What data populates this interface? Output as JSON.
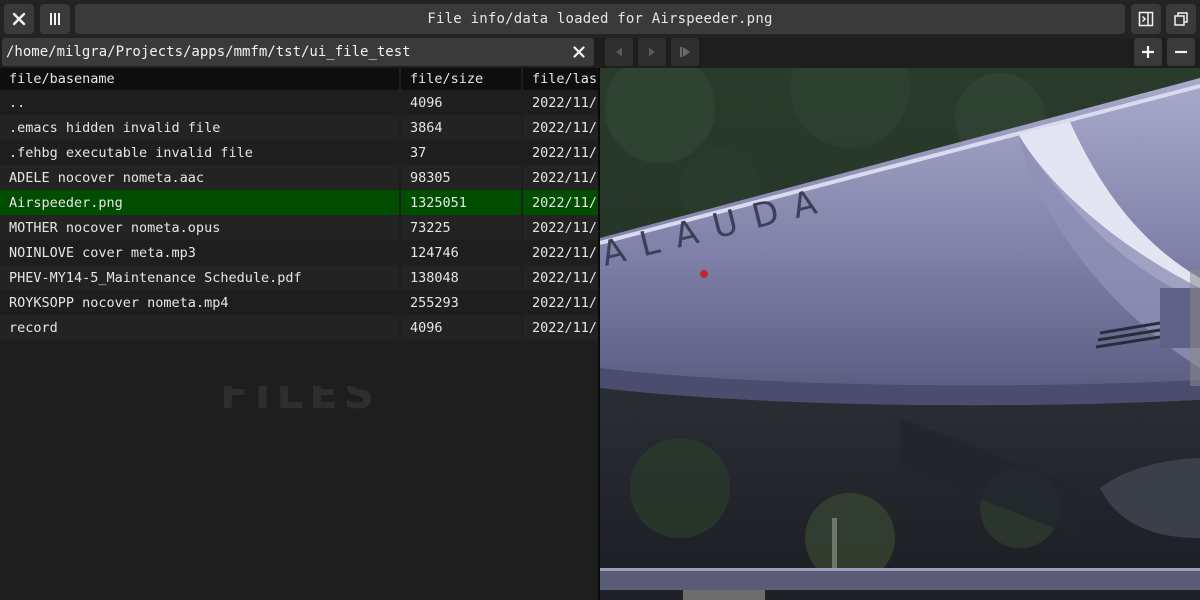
{
  "header": {
    "title": "File info/data loaded for Airspeeder.png",
    "icons": [
      "close-icon",
      "columns-icon",
      "sidebar-icon",
      "restore-icon"
    ]
  },
  "path": {
    "value": "/home/milgra/Projects/apps/mmfm/tst/ui_file_test"
  },
  "watermark": "FILES",
  "table": {
    "columns": [
      "file/basename",
      "file/size",
      "file/last_modified"
    ],
    "rows": [
      [
        "..",
        "4096",
        "2022/11/"
      ],
      [
        ".emacs hidden invalid file",
        "3864",
        "2022/11/"
      ],
      [
        ".fehbg executable invalid file",
        "37",
        "2022/11/"
      ],
      [
        "ADELE nocover nometa.aac",
        "98305",
        "2022/11/"
      ],
      [
        "Airspeeder.png",
        "1325051",
        "2022/11/"
      ],
      [
        "MOTHER nocover nometa.opus",
        "73225",
        "2022/11/"
      ],
      [
        "NOINLOVE cover meta.mp3",
        "124746",
        "2022/11/"
      ],
      [
        "PHEV-MY14-5_Maintenance Schedule.pdf",
        "138048",
        "2022/11/"
      ],
      [
        "ROYKSOPP nocover nometa.mp4",
        "255293",
        "2022/11/"
      ],
      [
        "record",
        "4096",
        "2022/11/"
      ]
    ],
    "selected_index": 4
  },
  "colors": {
    "selected_row": "#004d00",
    "button_bg": "#3a3a3a",
    "background": "#1e1e1e"
  },
  "preview": {
    "lettering": "ALAUDA"
  }
}
